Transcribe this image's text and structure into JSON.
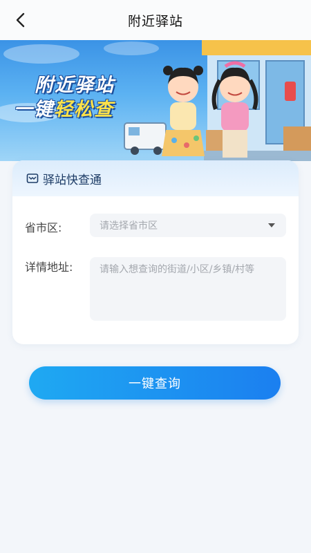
{
  "header": {
    "title": "附近驿站",
    "back_icon": "chevron-left-icon"
  },
  "banner": {
    "line1": "附近驿站",
    "line2_prefix": "一键",
    "line2_highlight": "轻松查"
  },
  "card": {
    "title": "驿站快查通",
    "title_icon": "package-box-icon",
    "region": {
      "label": "省市区:",
      "placeholder": "请选择省市区"
    },
    "address": {
      "label": "详情地址:",
      "placeholder": "请输入想查询的街道/小区/乡镇/村等",
      "value": ""
    }
  },
  "actions": {
    "query_label": "一键查询"
  },
  "colors": {
    "accent": "#1b85f0",
    "banner_highlight": "#ffe24a"
  }
}
